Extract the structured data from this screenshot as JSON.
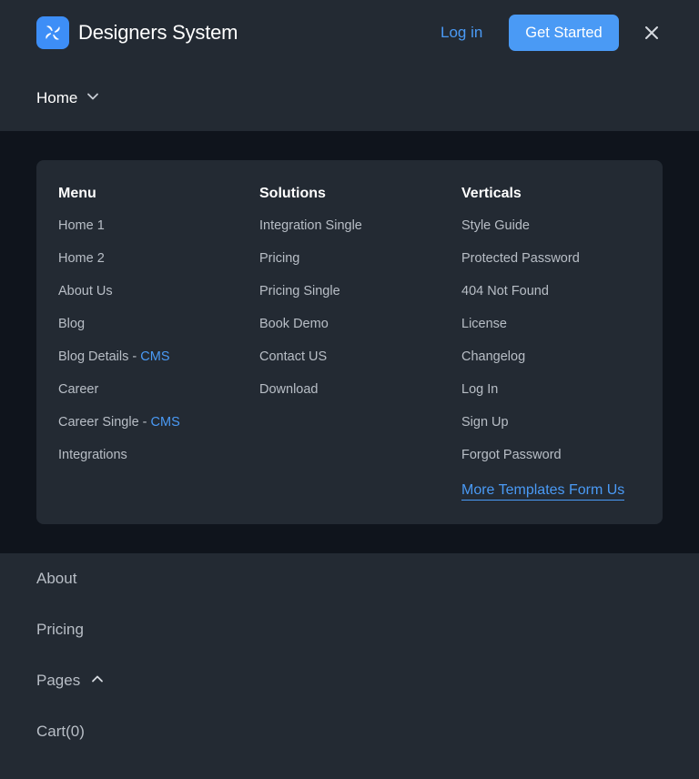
{
  "header": {
    "brand": "Designers System",
    "login_label": "Log in",
    "cta_label": "Get Started",
    "icons": {
      "logo": "pinwheel-logo-icon",
      "close": "close-icon"
    }
  },
  "home_dropdown": {
    "label": "Home",
    "icon": "chevron-down-icon"
  },
  "mega_menu": {
    "columns": [
      {
        "title": "Menu",
        "items": [
          {
            "label": "Home 1"
          },
          {
            "label": "Home 2"
          },
          {
            "label": "About Us"
          },
          {
            "label": "Blog"
          },
          {
            "label": "Blog Details - ",
            "badge": "CMS"
          },
          {
            "label": "Career"
          },
          {
            "label": "Career Single - ",
            "badge": "CMS"
          },
          {
            "label": "Integrations"
          }
        ]
      },
      {
        "title": "Solutions",
        "items": [
          {
            "label": "Integration Single"
          },
          {
            "label": "Pricing"
          },
          {
            "label": "Pricing Single"
          },
          {
            "label": "Book Demo"
          },
          {
            "label": "Contact US"
          },
          {
            "label": "Download"
          }
        ]
      },
      {
        "title": "Verticals",
        "items": [
          {
            "label": "Style Guide"
          },
          {
            "label": "Protected Password"
          },
          {
            "label": "404 Not Found"
          },
          {
            "label": "License"
          },
          {
            "label": "Changelog"
          },
          {
            "label": "Log In"
          },
          {
            "label": "Sign Up"
          },
          {
            "label": "Forgot Password"
          }
        ],
        "more_link": "More Templates Form Us"
      }
    ]
  },
  "bottom_nav": [
    {
      "label": "About"
    },
    {
      "label": "Pricing"
    },
    {
      "label": "Pages",
      "icon": "chevron-up-icon"
    },
    {
      "label": "Cart(0)"
    }
  ],
  "colors": {
    "accent": "#4a9af5",
    "background": "#232a33",
    "dark_band": "#0f141c",
    "muted_text": "#b8bec6"
  }
}
